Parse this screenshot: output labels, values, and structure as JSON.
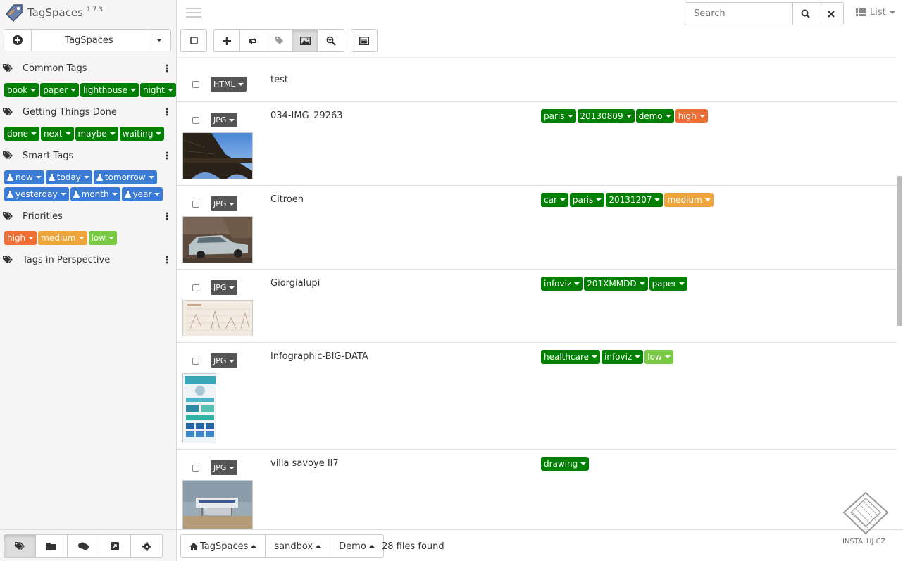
{
  "app": {
    "name": "TagSpaces",
    "version": "1.7.3"
  },
  "location": {
    "current": "TagSpaces"
  },
  "tag_groups": [
    {
      "title": "Common Tags",
      "tags": [
        {
          "label": "book",
          "color": "#008000"
        },
        {
          "label": "paper",
          "color": "#008000"
        },
        {
          "label": "lighthouse",
          "color": "#008000"
        },
        {
          "label": "night",
          "color": "#008000"
        }
      ]
    },
    {
      "title": "Getting Things Done",
      "tags": [
        {
          "label": "done",
          "color": "#008000"
        },
        {
          "label": "next",
          "color": "#008000"
        },
        {
          "label": "maybe",
          "color": "#008000"
        },
        {
          "label": "waiting",
          "color": "#008000"
        }
      ]
    },
    {
      "title": "Smart Tags",
      "tags": [
        {
          "label": "now",
          "color": "#3a7bd5"
        },
        {
          "label": "today",
          "color": "#3a7bd5"
        },
        {
          "label": "tomorrow",
          "color": "#3a7bd5"
        },
        {
          "label": "yesterday",
          "color": "#3a7bd5"
        },
        {
          "label": "month",
          "color": "#3a7bd5"
        },
        {
          "label": "year",
          "color": "#3a7bd5"
        }
      ]
    },
    {
      "title": "Priorities",
      "tags": [
        {
          "label": "high",
          "color": "#ee6e33"
        },
        {
          "label": "medium",
          "color": "#f0a53a"
        },
        {
          "label": "low",
          "color": "#7ac943"
        }
      ]
    },
    {
      "title": "Tags in Perspective",
      "tags": []
    }
  ],
  "search": {
    "placeholder": "Search"
  },
  "view": {
    "label": "List"
  },
  "files": [
    {
      "ext": "HTML",
      "name": "test",
      "tags": []
    },
    {
      "ext": "JPG",
      "name": "034-IMG_29263",
      "tags": [
        "paris",
        "20130809",
        "demo",
        "high"
      ]
    },
    {
      "ext": "JPG",
      "name": "Citroen",
      "tags": [
        "car",
        "paris",
        "20131207",
        "medium"
      ]
    },
    {
      "ext": "JPG",
      "name": "Giorgialupi",
      "tags": [
        "infoviz",
        "201XMMDD",
        "paper"
      ]
    },
    {
      "ext": "JPG",
      "name": "Infographic-BIG-DATA",
      "tags": [
        "healthcare",
        "infoviz",
        "low"
      ]
    },
    {
      "ext": "JPG",
      "name": "villa savoye II7",
      "tags": [
        "drawing"
      ]
    }
  ],
  "breadcrumb": [
    "TagSpaces",
    "sandbox",
    "Demo"
  ],
  "status": {
    "count": "28 files found"
  },
  "watermark": "INSTALUJ.CZ",
  "colors": {
    "green": "#008000",
    "blue": "#3a7bd5",
    "high": "#ee6e33",
    "medium": "#f0a53a",
    "low": "#7ac943",
    "ext_badge": "#555555"
  }
}
